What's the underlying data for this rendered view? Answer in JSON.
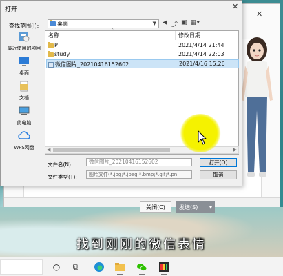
{
  "open_dialog": {
    "title": "打开",
    "close_glyph": "✕",
    "look_in_label": "查找范围(I):",
    "look_in_value": "桌面",
    "places": [
      {
        "label": "最近使用的项目",
        "icon": "recent-icon"
      },
      {
        "label": "桌面",
        "icon": "desktop-icon"
      },
      {
        "label": "文档",
        "icon": "documents-icon"
      },
      {
        "label": "此电脑",
        "icon": "this-pc-icon"
      },
      {
        "label": "WPS网盘",
        "icon": "wps-cloud-icon"
      }
    ],
    "columns": {
      "name": "名称",
      "date": "修改日期"
    },
    "files": [
      {
        "name": "P",
        "date": "2021/4/14 21:44",
        "type": "folder",
        "selected": false
      },
      {
        "name": "study",
        "date": "2021/4/14 22:03",
        "type": "folder",
        "selected": false
      },
      {
        "name": "微信图片_20210416152602",
        "date": "2021/4/16 15:26",
        "type": "image",
        "selected": true
      }
    ],
    "file_name_label": "文件名(N):",
    "file_name_value": "微信图片_20210416152602",
    "file_type_label": "文件类型(T):",
    "file_type_value": "图片文件(*.jpg;*.jpeg;*.bmp;*.gif;*.pn",
    "open_button": "打开(O)",
    "cancel_button": "取消"
  },
  "background_window": {
    "minimize_glyph": "—",
    "close_glyph": "✕",
    "close_button": "关闭(C)",
    "send_button": "发送(S)",
    "send_dropdown_glyph": "▾"
  },
  "subtitle": "找到刚刚的微信表情",
  "taskbar": {
    "icons": [
      "cortana-icon",
      "task-view-icon",
      "edge-icon",
      "file-explorer-icon",
      "wechat-icon",
      "app-icon"
    ]
  },
  "colors": {
    "selection": "#cce4f7",
    "highlight": "#f5f200",
    "primary_border": "#0078d7"
  }
}
